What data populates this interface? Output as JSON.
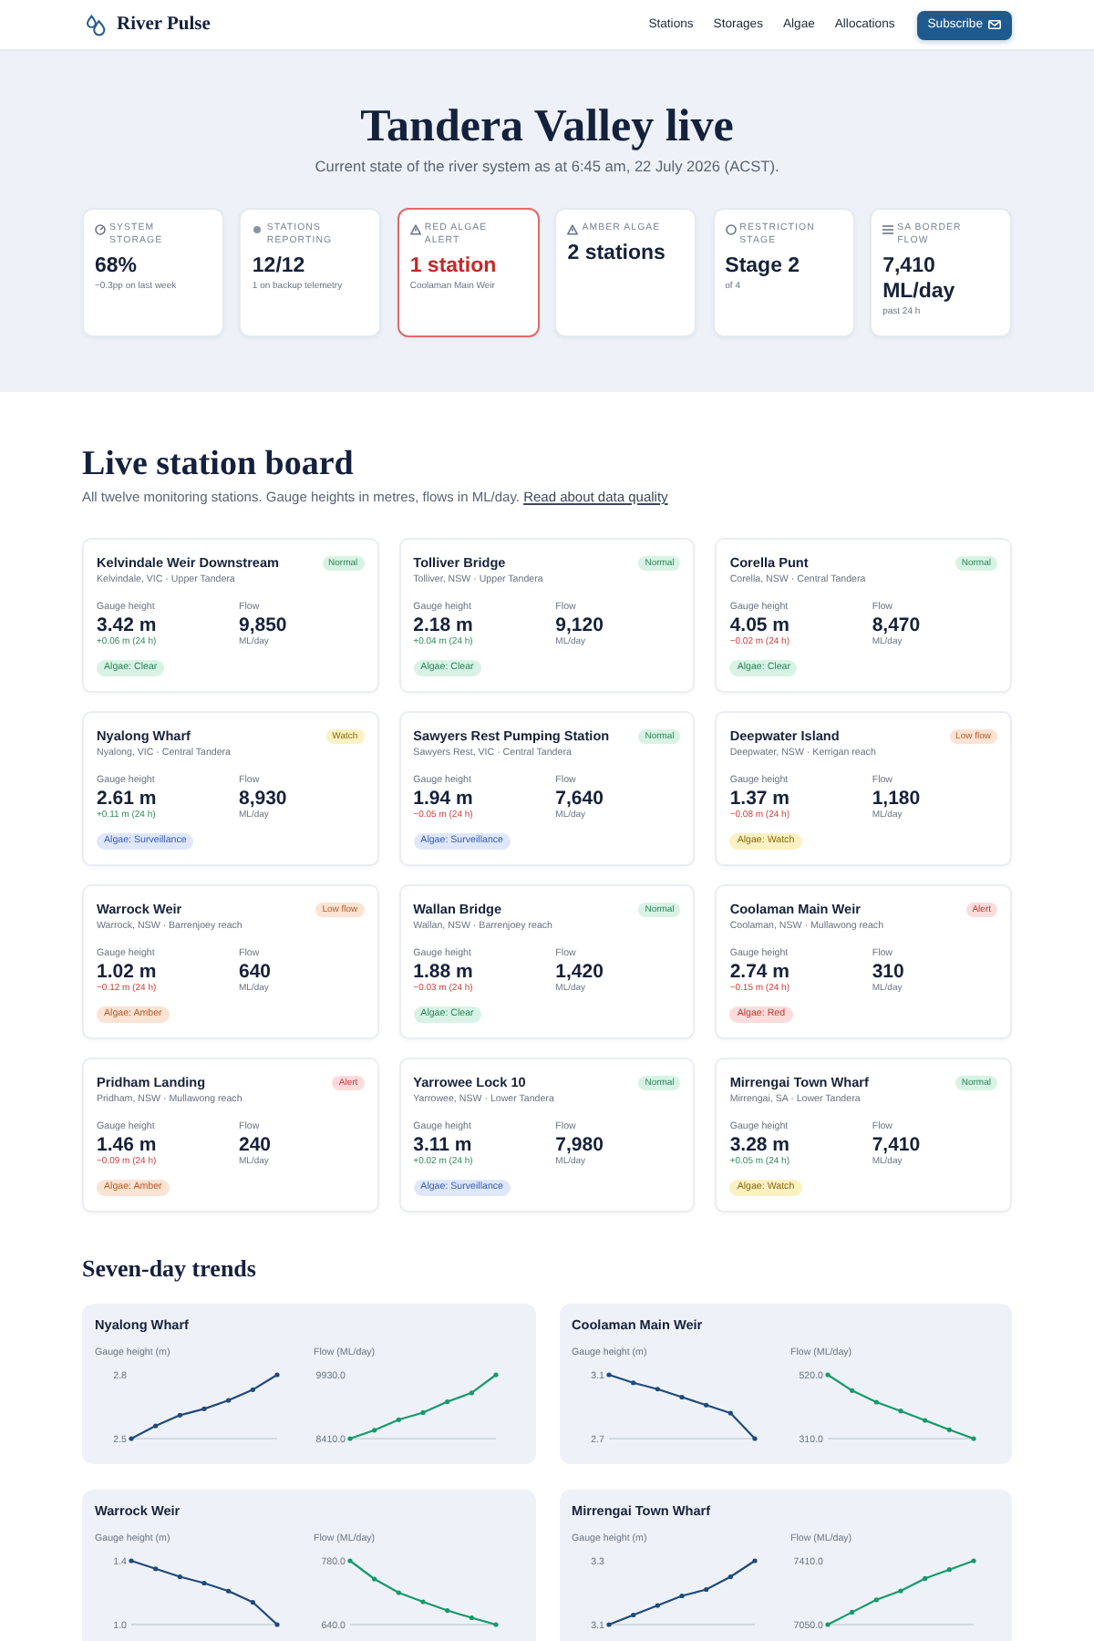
{
  "header": {
    "brand": "River Pulse",
    "nav": [
      {
        "label": "Stations"
      },
      {
        "label": "Storages"
      },
      {
        "label": "Algae"
      },
      {
        "label": "Allocations"
      }
    ],
    "subscribe": {
      "label": "Subscribe"
    }
  },
  "hero": {
    "title": "Tandera Valley live",
    "subtitle": "Current state of the river system as at 6:45 am, 22 July 2026 (ACST).",
    "stats": [
      {
        "kind": "storage",
        "label": "SYSTEM STORAGE",
        "value": "68%",
        "note": "−0.3pp on last week",
        "alert": false
      },
      {
        "kind": "reporting",
        "label": "STATIONS REPORTING",
        "value": "12/12",
        "note": "1 on backup telemetry",
        "alert": false
      },
      {
        "kind": "warning",
        "label": "RED ALGAE ALERT",
        "value": "1 station",
        "note": "Coolaman Main Weir",
        "alert": true
      },
      {
        "kind": "warning",
        "label": "AMBER ALGAE",
        "value": "2 stations",
        "alert": false
      },
      {
        "kind": "stage",
        "label": "RESTRICTION STAGE",
        "value": "Stage 2",
        "note": "of 4",
        "alert": false
      },
      {
        "kind": "flow",
        "label": "SA BORDER FLOW",
        "value": "7,410 ML/day",
        "note": "past 24 h",
        "alert": false
      }
    ]
  },
  "board": {
    "title": "Live station board",
    "intro": "All twelve monitoring stations. Gauge heights in metres, flows in ML/day.",
    "link": "Read about data quality",
    "stations": [
      {
        "name": "Kelvindale Weir Downstream",
        "location": "Kelvindale, VIC · Upper Tandera",
        "status": {
          "label": "Normal",
          "kind": "normal"
        },
        "gauge_label": "Gauge height",
        "gauge": "3.42 m",
        "gauge_change": {
          "text": "+0.06 m (24 h)",
          "rising": true
        },
        "flow_label": "Flow",
        "flow": "9,850",
        "flow_unit": "ML/day",
        "algae": {
          "label": "Algae: Clear",
          "kind": "clear"
        }
      },
      {
        "name": "Tolliver Bridge",
        "location": "Tolliver, NSW · Upper Tandera",
        "status": {
          "label": "Normal",
          "kind": "normal"
        },
        "gauge_label": "Gauge height",
        "gauge": "2.18 m",
        "gauge_change": {
          "text": "+0.04 m (24 h)",
          "rising": true
        },
        "flow_label": "Flow",
        "flow": "9,120",
        "flow_unit": "ML/day",
        "algae": {
          "label": "Algae: Clear",
          "kind": "clear"
        }
      },
      {
        "name": "Corella Punt",
        "location": "Corella, NSW · Central Tandera",
        "status": {
          "label": "Normal",
          "kind": "normal"
        },
        "gauge_label": "Gauge height",
        "gauge": "4.05 m",
        "gauge_change": {
          "text": "−0.02 m (24 h)",
          "rising": false
        },
        "flow_label": "Flow",
        "flow": "8,470",
        "flow_unit": "ML/day",
        "algae": {
          "label": "Algae: Clear",
          "kind": "clear"
        }
      },
      {
        "name": "Nyalong Wharf",
        "location": "Nyalong, VIC · Central Tandera",
        "status": {
          "label": "Watch",
          "kind": "watch"
        },
        "gauge_label": "Gauge height",
        "gauge": "2.61 m",
        "gauge_change": {
          "text": "+0.11 m (24 h)",
          "rising": true
        },
        "flow_label": "Flow",
        "flow": "8,930",
        "flow_unit": "ML/day",
        "algae": {
          "label": "Algae: Surveillance",
          "kind": "surveillance"
        }
      },
      {
        "name": "Sawyers Rest Pumping Station",
        "location": "Sawyers Rest, VIC · Central Tandera",
        "status": {
          "label": "Normal",
          "kind": "normal"
        },
        "gauge_label": "Gauge height",
        "gauge": "1.94 m",
        "gauge_change": {
          "text": "−0.05 m (24 h)",
          "rising": false
        },
        "flow_label": "Flow",
        "flow": "7,640",
        "flow_unit": "ML/day",
        "algae": {
          "label": "Algae: Surveillance",
          "kind": "surveillance"
        }
      },
      {
        "name": "Deepwater Island",
        "location": "Deepwater, NSW · Kerrigan reach",
        "status": {
          "label": "Low flow",
          "kind": "low_flow"
        },
        "gauge_label": "Gauge height",
        "gauge": "1.37 m",
        "gauge_change": {
          "text": "−0.08 m (24 h)",
          "rising": false
        },
        "flow_label": "Flow",
        "flow": "1,180",
        "flow_unit": "ML/day",
        "algae": {
          "label": "Algae: Watch",
          "kind": "watch"
        }
      },
      {
        "name": "Warrock Weir",
        "location": "Warrock, NSW · Barrenjoey reach",
        "status": {
          "label": "Low flow",
          "kind": "low_flow"
        },
        "gauge_label": "Gauge height",
        "gauge": "1.02 m",
        "gauge_change": {
          "text": "−0.12 m (24 h)",
          "rising": false
        },
        "flow_label": "Flow",
        "flow": "640",
        "flow_unit": "ML/day",
        "algae": {
          "label": "Algae: Amber",
          "kind": "amber"
        }
      },
      {
        "name": "Wallan Bridge",
        "location": "Wallan, NSW · Barrenjoey reach",
        "status": {
          "label": "Normal",
          "kind": "normal"
        },
        "gauge_label": "Gauge height",
        "gauge": "1.88 m",
        "gauge_change": {
          "text": "−0.03 m (24 h)",
          "rising": false
        },
        "flow_label": "Flow",
        "flow": "1,420",
        "flow_unit": "ML/day",
        "algae": {
          "label": "Algae: Clear",
          "kind": "clear"
        }
      },
      {
        "name": "Coolaman Main Weir",
        "location": "Coolaman, NSW · Mullawong reach",
        "status": {
          "label": "Alert",
          "kind": "alert"
        },
        "gauge_label": "Gauge height",
        "gauge": "2.74 m",
        "gauge_change": {
          "text": "−0.15 m (24 h)",
          "rising": false
        },
        "flow_label": "Flow",
        "flow": "310",
        "flow_unit": "ML/day",
        "algae": {
          "label": "Algae: Red",
          "kind": "red"
        }
      },
      {
        "name": "Pridham Landing",
        "location": "Pridham, NSW · Mullawong reach",
        "status": {
          "label": "Alert",
          "kind": "alert"
        },
        "gauge_label": "Gauge height",
        "gauge": "1.46 m",
        "gauge_change": {
          "text": "−0.09 m (24 h)",
          "rising": false
        },
        "flow_label": "Flow",
        "flow": "240",
        "flow_unit": "ML/day",
        "algae": {
          "label": "Algae: Amber",
          "kind": "amber"
        }
      },
      {
        "name": "Yarrowee Lock 10",
        "location": "Yarrowee, NSW · Lower Tandera",
        "status": {
          "label": "Normal",
          "kind": "normal"
        },
        "gauge_label": "Gauge height",
        "gauge": "3.11 m",
        "gauge_change": {
          "text": "+0.02 m (24 h)",
          "rising": true
        },
        "flow_label": "Flow",
        "flow": "7,980",
        "flow_unit": "ML/day",
        "algae": {
          "label": "Algae: Surveillance",
          "kind": "surveillance"
        }
      },
      {
        "name": "Mirrengai Town Wharf",
        "location": "Mirrengai, SA · Lower Tandera",
        "status": {
          "label": "Normal",
          "kind": "normal"
        },
        "gauge_label": "Gauge height",
        "gauge": "3.28 m",
        "gauge_change": {
          "text": "+0.05 m (24 h)",
          "rising": true
        },
        "flow_label": "Flow",
        "flow": "7,410",
        "flow_unit": "ML/day",
        "algae": {
          "label": "Algae: Watch",
          "kind": "watch"
        }
      }
    ]
  },
  "trends": {
    "title": "Seven-day trends",
    "cards": [
      {
        "station": "Nyalong Wharf",
        "charts": [
          {
            "chart_data": {
              "type": "line",
              "title": "Gauge height (m)",
              "ylim": [
                2.5,
                2.8
              ],
              "yticks": [
                {
                  "value": 2.5,
                  "label": "2.5"
                },
                {
                  "value": 2.8,
                  "label": "2.8"
                }
              ],
              "series": [
                {
                  "color": "#1f4a7a",
                  "values": [
                    2.5,
                    2.56,
                    2.61,
                    2.64,
                    2.68,
                    2.73,
                    2.8
                  ]
                }
              ]
            }
          },
          {
            "chart_data": {
              "type": "line",
              "title": "Flow (ML/day)",
              "ylim": [
                8410,
                9930
              ],
              "yticks": [
                {
                  "value": 8410,
                  "label": "8410.0"
                },
                {
                  "value": 9930,
                  "label": "9930.0"
                }
              ],
              "series": [
                {
                  "color": "#16996b",
                  "values": [
                    8410,
                    8610,
                    8860,
                    9030,
                    9290,
                    9500,
                    9930
                  ]
                }
              ]
            }
          }
        ]
      },
      {
        "station": "Coolaman Main Weir",
        "charts": [
          {
            "chart_data": {
              "type": "line",
              "title": "Gauge height (m)",
              "ylim": [
                2.7,
                3.1
              ],
              "yticks": [
                {
                  "value": 2.7,
                  "label": "2.7"
                },
                {
                  "value": 3.1,
                  "label": "3.1"
                }
              ],
              "series": [
                {
                  "color": "#1f4a7a",
                  "values": [
                    3.1,
                    3.05,
                    3.01,
                    2.96,
                    2.91,
                    2.86,
                    2.7
                  ]
                }
              ]
            }
          },
          {
            "chart_data": {
              "type": "line",
              "title": "Flow (ML/day)",
              "ylim": [
                310,
                520
              ],
              "yticks": [
                {
                  "value": 310,
                  "label": "310.0"
                },
                {
                  "value": 520,
                  "label": "520.0"
                }
              ],
              "series": [
                {
                  "color": "#16996b",
                  "values": [
                    520,
                    468,
                    430,
                    401,
                    370,
                    339,
                    310
                  ]
                }
              ]
            }
          }
        ]
      },
      {
        "station": "Warrock Weir",
        "charts": [
          {
            "chart_data": {
              "type": "line",
              "title": "Gauge height (m)",
              "ylim": [
                1.0,
                1.4
              ],
              "yticks": [
                {
                  "value": 1.0,
                  "label": "1.0"
                },
                {
                  "value": 1.4,
                  "label": "1.4"
                }
              ],
              "series": [
                {
                  "color": "#1f4a7a",
                  "values": [
                    1.4,
                    1.35,
                    1.3,
                    1.26,
                    1.21,
                    1.14,
                    1.0
                  ]
                }
              ]
            }
          },
          {
            "chart_data": {
              "type": "line",
              "title": "Flow (ML/day)",
              "ylim": [
                640,
                780
              ],
              "yticks": [
                {
                  "value": 640,
                  "label": "640.0"
                },
                {
                  "value": 780,
                  "label": "780.0"
                }
              ],
              "series": [
                {
                  "color": "#16996b",
                  "values": [
                    780,
                    740,
                    710,
                    690,
                    671,
                    655,
                    640
                  ]
                }
              ]
            }
          }
        ]
      },
      {
        "station": "Mirrengai Town Wharf",
        "charts": [
          {
            "chart_data": {
              "type": "line",
              "title": "Gauge height (m)",
              "ylim": [
                3.1,
                3.3
              ],
              "yticks": [
                {
                  "value": 3.1,
                  "label": "3.1"
                },
                {
                  "value": 3.3,
                  "label": "3.3"
                }
              ],
              "series": [
                {
                  "color": "#1f4a7a",
                  "values": [
                    3.1,
                    3.13,
                    3.16,
                    3.19,
                    3.21,
                    3.25,
                    3.3
                  ]
                }
              ]
            }
          },
          {
            "chart_data": {
              "type": "line",
              "title": "Flow (ML/day)",
              "ylim": [
                7050,
                7410
              ],
              "yticks": [
                {
                  "value": 7050,
                  "label": "7050.0"
                },
                {
                  "value": 7410,
                  "label": "7410.0"
                }
              ],
              "series": [
                {
                  "color": "#16996b",
                  "values": [
                    7050,
                    7120,
                    7190,
                    7240,
                    7310,
                    7360,
                    7410
                  ]
                }
              ]
            }
          }
        ]
      }
    ]
  }
}
